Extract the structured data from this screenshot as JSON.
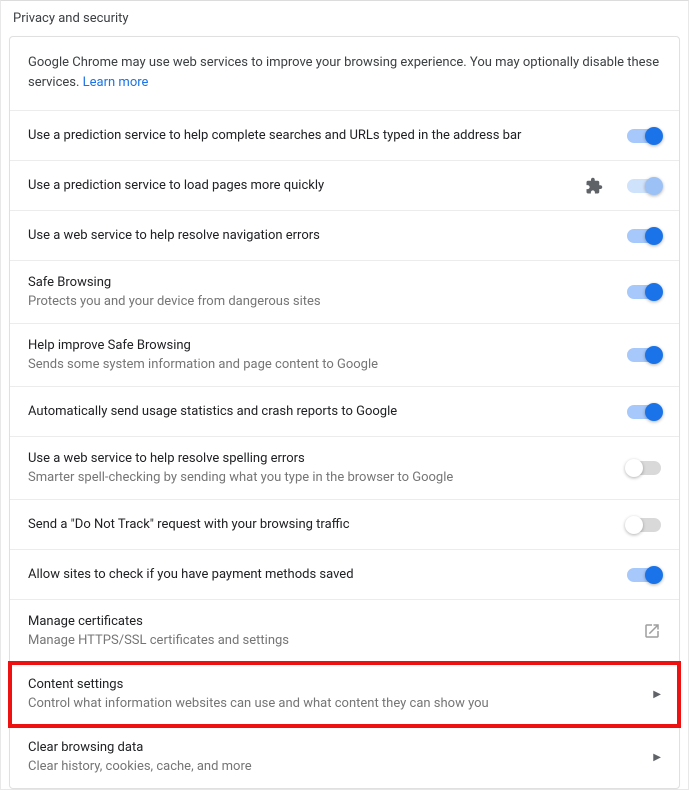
{
  "header": {
    "title": "Privacy and security"
  },
  "intro": {
    "text": "Google Chrome may use web services to improve your browsing experience. You may optionally disable these services. ",
    "learn_more": "Learn more"
  },
  "rows": {
    "prediction_search": {
      "label": "Use a prediction service to help complete searches and URLs typed in the address bar",
      "state": "on"
    },
    "prediction_pages": {
      "label": "Use a prediction service to load pages more quickly",
      "state": "on-managed",
      "icon": "extension"
    },
    "nav_errors": {
      "label": "Use a web service to help resolve navigation errors",
      "state": "on"
    },
    "safe_browsing": {
      "label": "Safe Browsing",
      "desc": "Protects you and your device from dangerous sites",
      "state": "on"
    },
    "improve_safe_browsing": {
      "label": "Help improve Safe Browsing",
      "desc": "Sends some system information and page content to Google",
      "state": "on"
    },
    "usage_stats": {
      "label": "Automatically send usage statistics and crash reports to Google",
      "state": "on"
    },
    "spelling": {
      "label": "Use a web service to help resolve spelling errors",
      "desc": "Smarter spell-checking by sending what you type in the browser to Google",
      "state": "off"
    },
    "dnt": {
      "label": "Send a \"Do Not Track\" request with your browsing traffic",
      "state": "off"
    },
    "payment": {
      "label": "Allow sites to check if you have payment methods saved",
      "state": "on"
    },
    "certs": {
      "label": "Manage certificates",
      "desc": "Manage HTTPS/SSL certificates and settings"
    },
    "content": {
      "label": "Content settings",
      "desc": "Control what information websites can use and what content they can show you"
    },
    "clear": {
      "label": "Clear browsing data",
      "desc": "Clear history, cookies, cache, and more"
    }
  }
}
